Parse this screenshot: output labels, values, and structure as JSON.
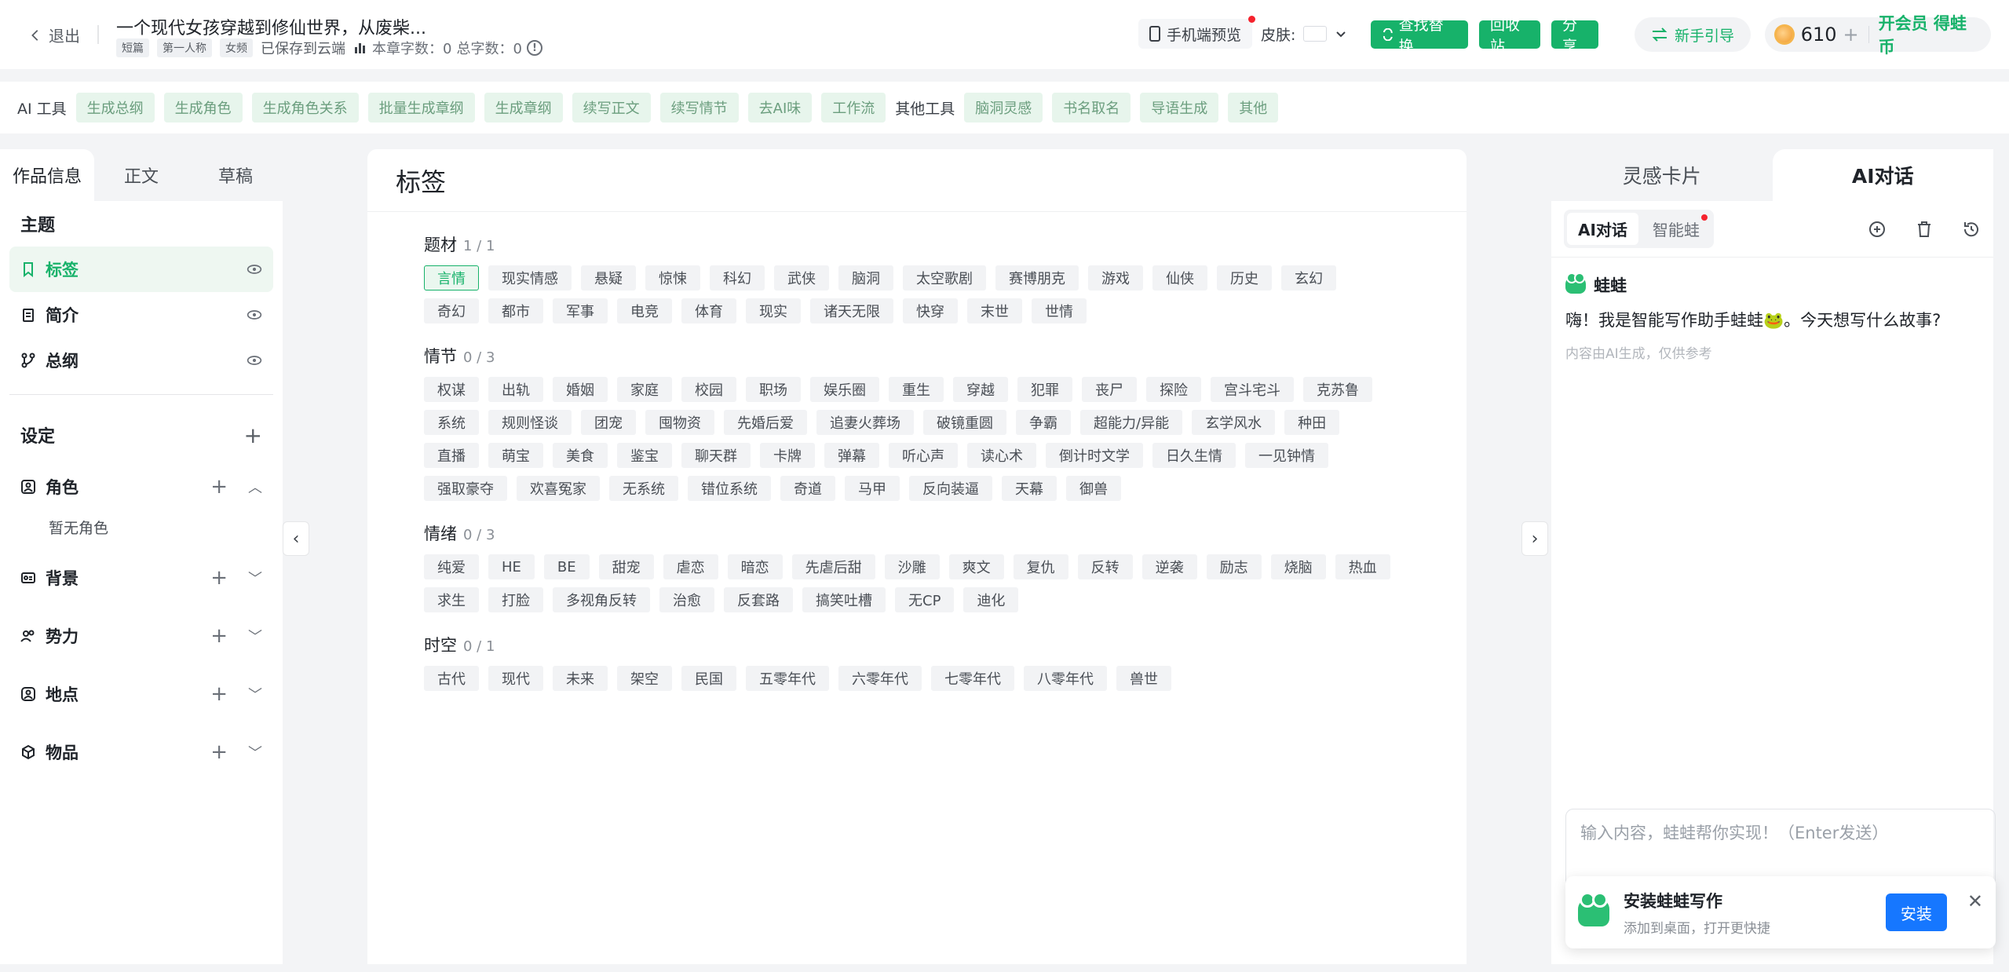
{
  "topbar": {
    "back_label": "退出",
    "title": "一个现代女孩穿越到修仙世界，从废柴...",
    "chips": [
      "短篇",
      "第一人称",
      "女频"
    ],
    "save_status": "已保存到云端",
    "chapter_words": "本章字数：0",
    "total_words": "总字数：0",
    "preview_label": "手机端预览",
    "skin_label": "皮肤:",
    "find_replace_label": "查找替换",
    "recycle_label": "回收站",
    "share_label": "分享",
    "guide_label": "新手引导",
    "coins": "610",
    "vip_label": "开会员 得蛙币"
  },
  "toolbar": {
    "ai_label": "AI 工具",
    "ai_tools": [
      "生成总纲",
      "生成角色",
      "生成角色关系",
      "批量生成章纲",
      "生成章纲",
      "续写正文",
      "续写情节",
      "去AI味",
      "工作流"
    ],
    "other_label": "其他工具",
    "other_tools": [
      "脑洞灵感",
      "书名取名",
      "导语生成",
      "其他"
    ]
  },
  "left": {
    "tabs": [
      "作品信息",
      "正文",
      "草稿"
    ],
    "theme_title": "主题",
    "nav": [
      {
        "label": "标签"
      },
      {
        "label": "简介"
      },
      {
        "label": "总纲"
      }
    ],
    "settings_title": "设定",
    "groups": {
      "roles": "角色",
      "roles_empty": "暂无角色",
      "background": "背景",
      "forces": "势力",
      "places": "地点",
      "items": "物品"
    }
  },
  "center": {
    "title": "标签",
    "categories": [
      {
        "name": "题材",
        "count": "1 / 1",
        "selected": "言情",
        "tags": [
          "言情",
          "现实情感",
          "悬疑",
          "惊悚",
          "科幻",
          "武侠",
          "脑洞",
          "太空歌剧",
          "赛博朋克",
          "游戏",
          "仙侠",
          "历史",
          "玄幻",
          "奇幻",
          "都市",
          "军事",
          "电竞",
          "体育",
          "现实",
          "诸天无限",
          "快穿",
          "末世",
          "世情"
        ]
      },
      {
        "name": "情节",
        "count": "0 / 3",
        "selected": "",
        "tags": [
          "权谋",
          "出轨",
          "婚姻",
          "家庭",
          "校园",
          "职场",
          "娱乐圈",
          "重生",
          "穿越",
          "犯罪",
          "丧尸",
          "探险",
          "宫斗宅斗",
          "克苏鲁",
          "系统",
          "规则怪谈",
          "团宠",
          "囤物资",
          "先婚后爱",
          "追妻火葬场",
          "破镜重圆",
          "争霸",
          "超能力/异能",
          "玄学风水",
          "种田",
          "直播",
          "萌宝",
          "美食",
          "鉴宝",
          "聊天群",
          "卡牌",
          "弹幕",
          "听心声",
          "读心术",
          "倒计时文学",
          "日久生情",
          "一见钟情",
          "强取豪夺",
          "欢喜冤家",
          "无系统",
          "错位系统",
          "奇道",
          "马甲",
          "反向装逼",
          "天幕",
          "御兽"
        ]
      },
      {
        "name": "情绪",
        "count": "0 / 3",
        "selected": "",
        "tags": [
          "纯爱",
          "HE",
          "BE",
          "甜宠",
          "虐恋",
          "暗恋",
          "先虐后甜",
          "沙雕",
          "爽文",
          "复仇",
          "反转",
          "逆袭",
          "励志",
          "烧脑",
          "热血",
          "求生",
          "打脸",
          "多视角反转",
          "治愈",
          "反套路",
          "搞笑吐槽",
          "无CP",
          "迪化"
        ]
      },
      {
        "name": "时空",
        "count": "0 / 1",
        "selected": "",
        "tags": [
          "古代",
          "现代",
          "未来",
          "架空",
          "民国",
          "五零年代",
          "六零年代",
          "七零年代",
          "八零年代",
          "兽世"
        ]
      }
    ]
  },
  "right": {
    "tabs": [
      "灵感卡片",
      "AI对话"
    ],
    "seg": [
      "AI对话",
      "智能蛙"
    ],
    "bot_name": "蛙蛙",
    "greeting": "嗨！我是智能写作助手蛙蛙🐸。今天想写什么故事?",
    "note": "内容由AI生成，仅供参考",
    "input_placeholder": "输入内容，蛙蛙帮你实现！（Enter发送）",
    "install_title": "安装蛙蛙写作",
    "install_sub": "添加到桌面，打开更快捷",
    "install_btn": "安装"
  },
  "colors": {
    "accent": "#17b26a",
    "install_blue": "#1677ff",
    "alert_dot": "#f5222d"
  }
}
